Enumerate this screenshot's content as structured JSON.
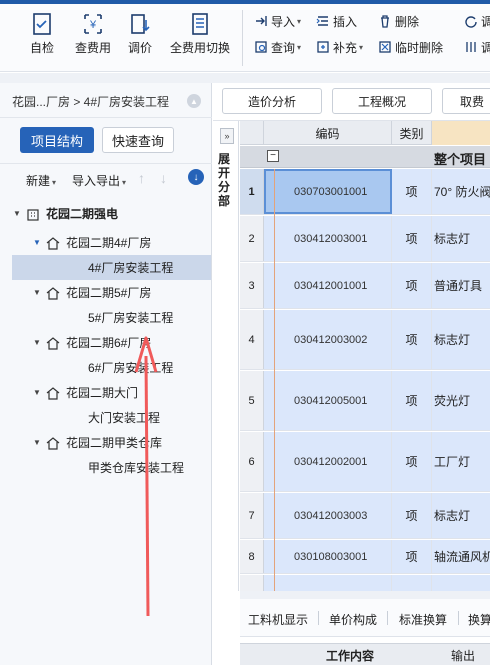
{
  "ribbon": {
    "big_buttons": [
      {
        "label": "自检",
        "icon": "check-doc-icon"
      },
      {
        "label": "查费用",
        "icon": "search-fee-icon"
      },
      {
        "label": "调价",
        "icon": "adjust-price-icon"
      },
      {
        "label": "全费用切换",
        "icon": "switch-fee-icon"
      }
    ],
    "small_buttons": [
      {
        "label": "导入",
        "icon": "import-icon"
      },
      {
        "label": "插入",
        "icon": "insert-icon"
      },
      {
        "label": "删除",
        "icon": "trash-icon"
      },
      {
        "label": "查询",
        "icon": "query-icon"
      },
      {
        "label": "补充",
        "icon": "supplement-icon"
      },
      {
        "label": "临时删除",
        "icon": "temp-delete-icon"
      }
    ],
    "cut_off": [
      "调"
    ]
  },
  "left": {
    "breadcrumb": "花园...厂房 > 4#厂房安装工程",
    "tab_active": "项目结构",
    "tab_other": "快速查询",
    "toolbar": {
      "new": "新建",
      "import_export": "导入导出"
    },
    "tree": [
      {
        "label": "花园二期强电",
        "level": 0,
        "icon": "building-icon"
      },
      {
        "label": "花园二期4#厂房",
        "level": 1,
        "icon": "house-icon"
      },
      {
        "label": "4#厂房安装工程",
        "level": 2,
        "selected": true
      },
      {
        "label": "花园二期5#厂房",
        "level": 1,
        "icon": "house-icon"
      },
      {
        "label": "5#厂房安装工程",
        "level": 2
      },
      {
        "label": "花园二期6#厂房",
        "level": 1,
        "icon": "house-icon"
      },
      {
        "label": "6#厂房安装工程",
        "level": 2
      },
      {
        "label": "花园二期大门",
        "level": 1,
        "icon": "house-icon"
      },
      {
        "label": "大门安装工程",
        "level": 2
      },
      {
        "label": "花园二期甲类仓库",
        "level": 1,
        "icon": "house-icon"
      },
      {
        "label": "甲类仓库安装工程",
        "level": 2
      }
    ]
  },
  "mid_tabs": [
    "造价分析",
    "工程概况",
    "取费"
  ],
  "expand": {
    "button": "»",
    "label": "展开分部"
  },
  "grid": {
    "headers": {
      "code": "编码",
      "type": "类别"
    },
    "group": {
      "toggle": "−",
      "title": "整个项目"
    },
    "rows": [
      {
        "num": "1",
        "code": "030703001001",
        "type": "项",
        "name": "70° 防火阀"
      },
      {
        "num": "2",
        "code": "030412003001",
        "type": "项",
        "name": "标志灯"
      },
      {
        "num": "3",
        "code": "030412001001",
        "type": "项",
        "name": "普通灯具"
      },
      {
        "num": "4",
        "code": "030412003002",
        "type": "项",
        "name": "标志灯"
      },
      {
        "num": "5",
        "code": "030412005001",
        "type": "项",
        "name": "荧光灯"
      },
      {
        "num": "6",
        "code": "030412002001",
        "type": "项",
        "name": "工厂灯"
      },
      {
        "num": "7",
        "code": "030412003003",
        "type": "项",
        "name": "标志灯"
      },
      {
        "num": "8",
        "code": "030108003001",
        "type": "项",
        "name": "轴流通风机"
      }
    ]
  },
  "bottom": {
    "tabs": [
      "工料机显示",
      "单价构成",
      "标准换算",
      "换算"
    ],
    "headers": {
      "content": "工作内容",
      "output": "输出"
    }
  },
  "colors": {
    "accent": "#2663b8",
    "annotation": "#f05a5a",
    "selected_row": "#a9c8f0"
  }
}
